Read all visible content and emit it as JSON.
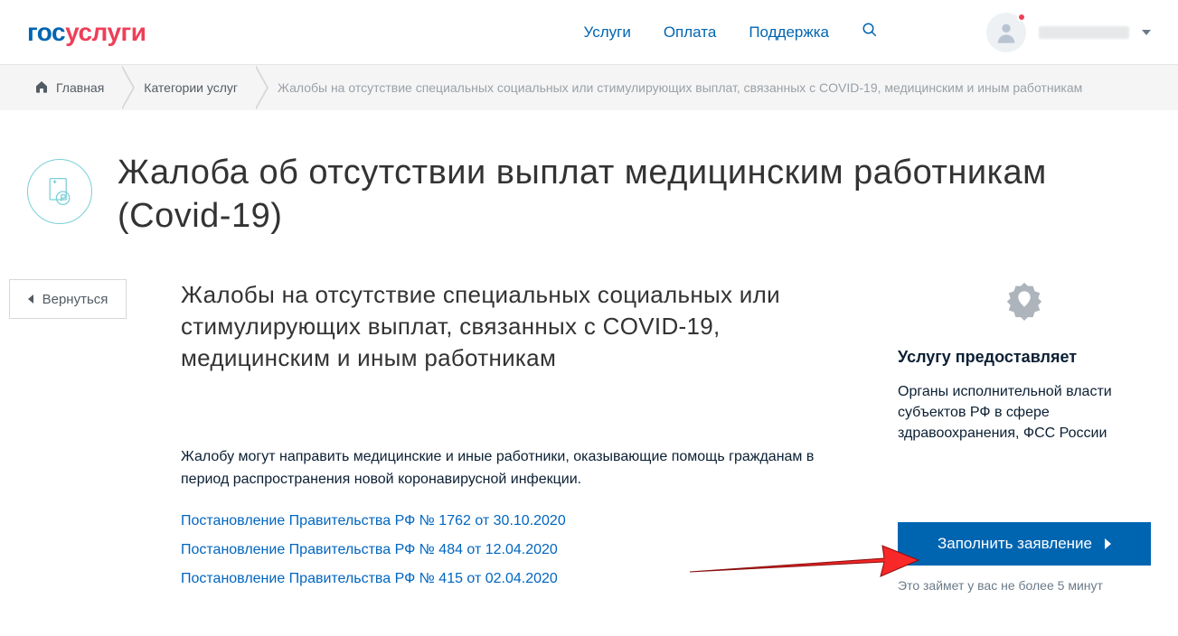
{
  "logo": {
    "p1": "гос",
    "p2": "услуги"
  },
  "nav": {
    "services": "Услуги",
    "payment": "Оплата",
    "support": "Поддержка"
  },
  "breadcrumb": {
    "home": "Главная",
    "categories": "Категории услуг",
    "current": "Жалобы на отсутствие специальных социальных или стимулирующих выплат, связанных с COVID-19, медицинским и иным работникам"
  },
  "page_title": "Жалоба об отсутствии выплат медицинским работникам (Covid-19)",
  "back_label": "Вернуться",
  "subtitle": "Жалобы на отсутствие специальных социальных или стимулирующих выплат, связанных с COVID-19, медицинским и иным работникам",
  "description": "Жалобу могут направить медицинские и иные работники, оказывающие помощь гражданам в период распространения новой коронавирусной инфекции.",
  "links": [
    "Постановление Правительства РФ № 1762 от 30.10.2020",
    "Постановление Правительства РФ № 484 от 12.04.2020",
    "Постановление Правительства РФ № 415 от 02.04.2020"
  ],
  "provider": {
    "heading": "Услугу предоставляет",
    "text": "Органы исполнительной власти субъектов РФ в сфере здравоохранения, ФСС России"
  },
  "cta": {
    "label": "Заполнить заявление",
    "note": "Это займет у вас не более 5 минут"
  }
}
